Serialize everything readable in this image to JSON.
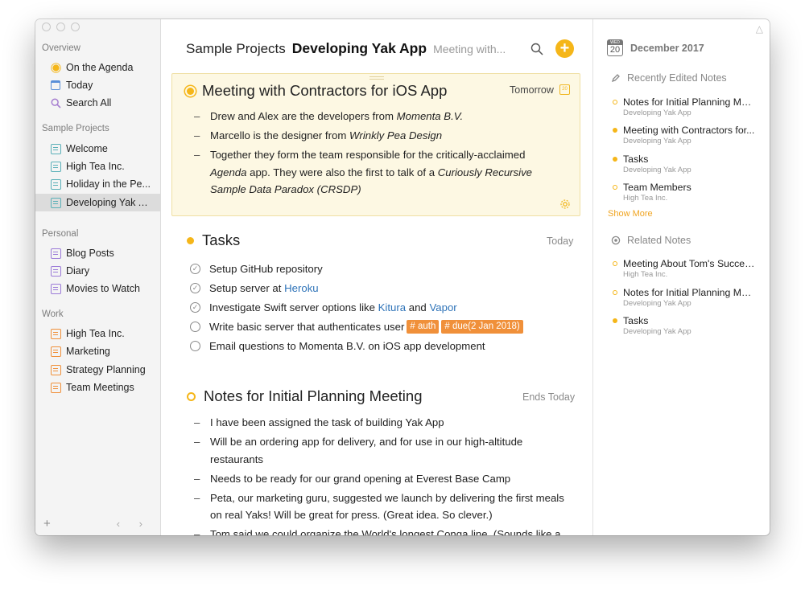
{
  "sidebar": {
    "sections": {
      "overview": "Overview",
      "projects": "Sample Projects",
      "personal": "Personal",
      "work": "Work"
    },
    "overview_items": [
      "On the Agenda",
      "Today",
      "Search All"
    ],
    "project_items": [
      "Welcome",
      "High Tea Inc.",
      "Holiday in the Pe...",
      "Developing Yak A..."
    ],
    "personal_items": [
      "Blog Posts",
      "Diary",
      "Movies to Watch"
    ],
    "work_items": [
      "High Tea Inc.",
      "Marketing",
      "Strategy Planning",
      "Team Meetings"
    ],
    "add_label": "+",
    "nav_label": "‹ ›"
  },
  "header": {
    "project": "Sample Projects",
    "note": "Developing Yak App",
    "subtitle": "Meeting with...",
    "add_label": "+"
  },
  "notes": [
    {
      "title": "Meeting with Contractors for iOS App",
      "date": "Tomorrow",
      "calendar_day": "20",
      "bullets": [
        [
          "Drew and Alex are the developers from ",
          "Momenta B.V.",
          ""
        ],
        [
          "Marcello is the designer from ",
          "Wrinkly Pea Design",
          ""
        ],
        [
          "Together they form the team responsible for the critically-acclaimed ",
          "Agenda",
          " app. They were also the first to talk of a ",
          "Curiously Recursive Sample Data Paradox (CRSDP)"
        ]
      ]
    },
    {
      "title": "Tasks",
      "date": "Today",
      "tasks": [
        {
          "text": "Setup GitHub repository",
          "done": true
        },
        {
          "text": "Setup server at ",
          "link": "Heroku",
          "done": true
        },
        {
          "text": "Investigate Swift server options like ",
          "link": "Kitura",
          "mid": " and ",
          "link2": "Vapor",
          "done": true
        },
        {
          "text": "Write basic server that authenticates user",
          "tags": [
            "auth",
            "due(2 Jan 2018)"
          ],
          "done": false
        },
        {
          "text": "Email questions to Momenta B.V. on iOS app development",
          "done": false
        }
      ]
    },
    {
      "title": "Notes for Initial Planning Meeting",
      "date": "Ends Today",
      "bullets": [
        "I have been assigned the task of building Yak App",
        "Will be an ordering app for delivery, and for use in our high-altitude restaurants",
        "Needs to be ready for our grand opening at Everest Base Camp",
        "Peta, our marketing guru, suggested we launch by delivering the first meals on real Yaks! Will be great for press. (Great idea. So clever.)",
        "Tom said we could organize the World's longest Conga line. (Sounds like a"
      ]
    }
  ],
  "right_panel": {
    "weekday": "WED",
    "day": "20",
    "date": "December 2017",
    "recent_heading": "Recently Edited Notes",
    "recent": [
      {
        "title": "Notes for Initial Planning Mee...",
        "project": "Developing Yak App",
        "style": "ring"
      },
      {
        "title": "Meeting with Contractors for...",
        "project": "Developing Yak App",
        "style": "filled"
      },
      {
        "title": "Tasks",
        "project": "Developing Yak App",
        "style": "filled"
      },
      {
        "title": "Team Members",
        "project": "High Tea Inc.",
        "style": "ring"
      }
    ],
    "show_more": "Show More",
    "related_heading": "Related Notes",
    "related": [
      {
        "title": "Meeting About Tom's Succes...",
        "project": "High Tea Inc.",
        "style": "ring"
      },
      {
        "title": "Notes for Initial Planning Mee...",
        "project": "Developing Yak App",
        "style": "ring"
      },
      {
        "title": "Tasks",
        "project": "Developing Yak App",
        "style": "filled"
      }
    ]
  },
  "colors": {
    "accent": "#f5b619",
    "tag": "#f0903a",
    "link": "#2e73b8",
    "card_bg": "#fdf8e3"
  }
}
